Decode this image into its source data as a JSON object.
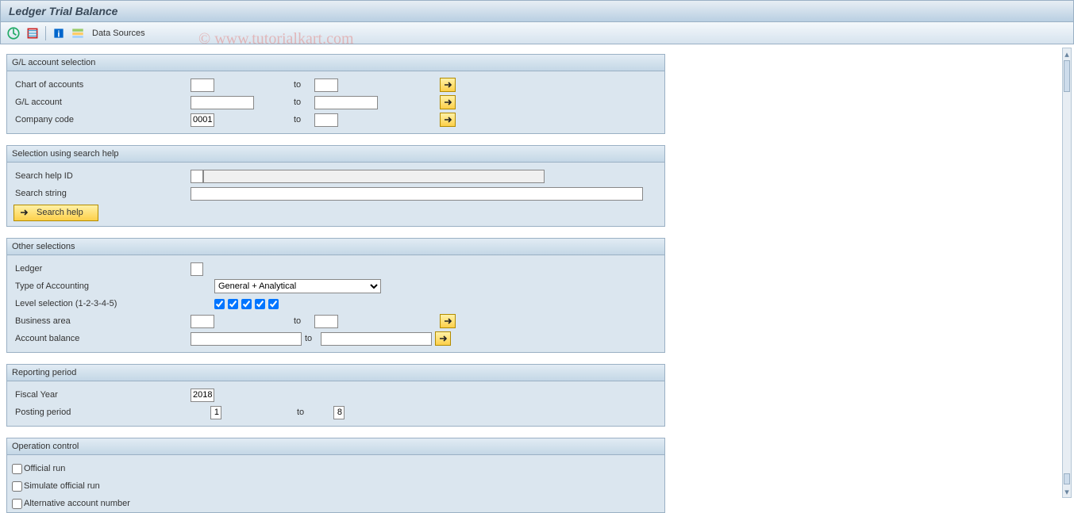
{
  "app_title": "Ledger Trial Balance",
  "watermark": "© www.tutorialkart.com",
  "toolbar": {
    "data_sources": "Data Sources"
  },
  "groups": {
    "gl_sel": {
      "title": "G/L account selection",
      "chart_of_accounts": "Chart of accounts",
      "gl_account": "G/L account",
      "company_code": "Company code",
      "company_code_val": "0001",
      "to": "to"
    },
    "search_help": {
      "title": "Selection using search help",
      "help_id": "Search help ID",
      "search_string": "Search string",
      "search_btn": "Search help"
    },
    "other": {
      "title": "Other selections",
      "ledger": "Ledger",
      "type_acc": "Type of Accounting",
      "type_acc_val": "General + Analytical",
      "level_sel": "Level selection (1-2-3-4-5)",
      "bus_area": "Business area",
      "acc_bal": "Account balance",
      "to": "to"
    },
    "period": {
      "title": "Reporting period",
      "fy_label": "Fiscal Year",
      "fy_val": "2018",
      "pp_label": "Posting period",
      "pp_from": "1",
      "pp_to": "8",
      "to": "to"
    },
    "opctrl": {
      "title": "Operation control",
      "official": "Official run",
      "simulate": "Simulate official run",
      "alt": "Alternative account number"
    }
  }
}
